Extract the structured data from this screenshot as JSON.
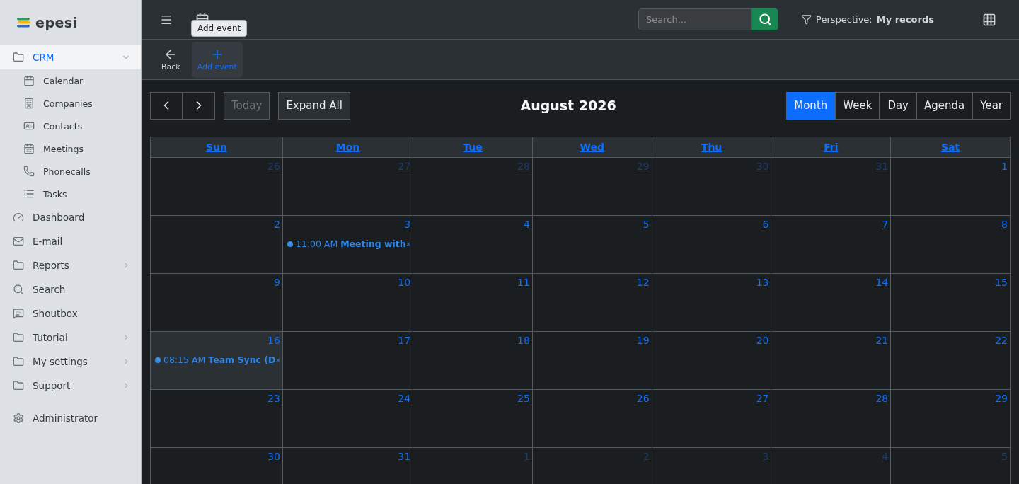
{
  "logo": {
    "text": "epesi"
  },
  "sidebar": {
    "items": [
      {
        "label": "CRM",
        "kind": "group",
        "selected": true,
        "expanded": true,
        "children": [
          {
            "label": "Calendar"
          },
          {
            "label": "Companies"
          },
          {
            "label": "Contacts"
          },
          {
            "label": "Meetings"
          },
          {
            "label": "Phonecalls"
          },
          {
            "label": "Tasks"
          }
        ]
      },
      {
        "label": "Dashboard",
        "kind": "link",
        "selected": false
      },
      {
        "label": "E-mail",
        "kind": "link",
        "selected": false
      },
      {
        "label": "Reports",
        "kind": "group",
        "selected": false,
        "expanded": false
      },
      {
        "label": "Search",
        "kind": "link",
        "selected": false
      },
      {
        "label": "Shoutbox",
        "kind": "link",
        "selected": false
      },
      {
        "label": "Tutorial",
        "kind": "group",
        "selected": false,
        "expanded": false
      },
      {
        "label": "My settings",
        "kind": "group",
        "selected": false,
        "expanded": false
      },
      {
        "label": "Support",
        "kind": "group",
        "selected": false,
        "expanded": false
      },
      {
        "label": "Administrator",
        "kind": "link",
        "selected": false
      }
    ]
  },
  "topbar": {
    "tooltip": "Add event",
    "search": {
      "placeholder": "Search..."
    },
    "perspective_label": "Perspective:",
    "perspective_value": "My records"
  },
  "actions": [
    {
      "label": "Back",
      "selected": false
    },
    {
      "label": "Add event",
      "selected": true
    }
  ],
  "calendar": {
    "today": {
      "label": "Today",
      "disabled": true
    },
    "expand": "Expand All",
    "title": "August 2026",
    "views": [
      {
        "label": "Month",
        "selected": true
      },
      {
        "label": "Week",
        "selected": false
      },
      {
        "label": "Day",
        "selected": false
      },
      {
        "label": "Agenda",
        "selected": false
      },
      {
        "label": "Year",
        "selected": false
      }
    ],
    "weekdays": [
      "Sun",
      "Mon",
      "Tue",
      "Wed",
      "Thu",
      "Fri",
      "Sat"
    ],
    "weeks": [
      [
        {
          "day": "26",
          "outside": true
        },
        {
          "day": "27",
          "outside": true
        },
        {
          "day": "28",
          "outside": true
        },
        {
          "day": "29",
          "outside": true
        },
        {
          "day": "30",
          "outside": true
        },
        {
          "day": "31",
          "outside": true
        },
        {
          "day": "1",
          "outside": false
        }
      ],
      [
        {
          "day": "2",
          "outside": false
        },
        {
          "day": "3",
          "outside": false,
          "events": [
            {
              "time": "11:00 AM",
              "title": "Meeting with",
              "close": "×"
            }
          ]
        },
        {
          "day": "4",
          "outside": false
        },
        {
          "day": "5",
          "outside": false
        },
        {
          "day": "6",
          "outside": false
        },
        {
          "day": "7",
          "outside": false
        },
        {
          "day": "8",
          "outside": false
        }
      ],
      [
        {
          "day": "9",
          "outside": false
        },
        {
          "day": "10",
          "outside": false
        },
        {
          "day": "11",
          "outside": false
        },
        {
          "day": "12",
          "outside": false
        },
        {
          "day": "13",
          "outside": false
        },
        {
          "day": "14",
          "outside": false
        },
        {
          "day": "15",
          "outside": false
        }
      ],
      [
        {
          "day": "16",
          "outside": false,
          "today": true,
          "events": [
            {
              "time": "08:15 AM",
              "title": "Team Sync (D",
              "close": "×"
            }
          ]
        },
        {
          "day": "17",
          "outside": false
        },
        {
          "day": "18",
          "outside": false
        },
        {
          "day": "19",
          "outside": false
        },
        {
          "day": "20",
          "outside": false
        },
        {
          "day": "21",
          "outside": false
        },
        {
          "day": "22",
          "outside": false
        }
      ],
      [
        {
          "day": "23",
          "outside": false
        },
        {
          "day": "24",
          "outside": false
        },
        {
          "day": "25",
          "outside": false
        },
        {
          "day": "26",
          "outside": false
        },
        {
          "day": "27",
          "outside": false
        },
        {
          "day": "28",
          "outside": false
        },
        {
          "day": "29",
          "outside": false
        }
      ],
      [
        {
          "day": "30",
          "outside": false
        },
        {
          "day": "31",
          "outside": false
        },
        {
          "day": "1",
          "outside": true
        },
        {
          "day": "2",
          "outside": true
        },
        {
          "day": "3",
          "outside": true
        },
        {
          "day": "4",
          "outside": true
        },
        {
          "day": "5",
          "outside": true
        }
      ]
    ]
  }
}
